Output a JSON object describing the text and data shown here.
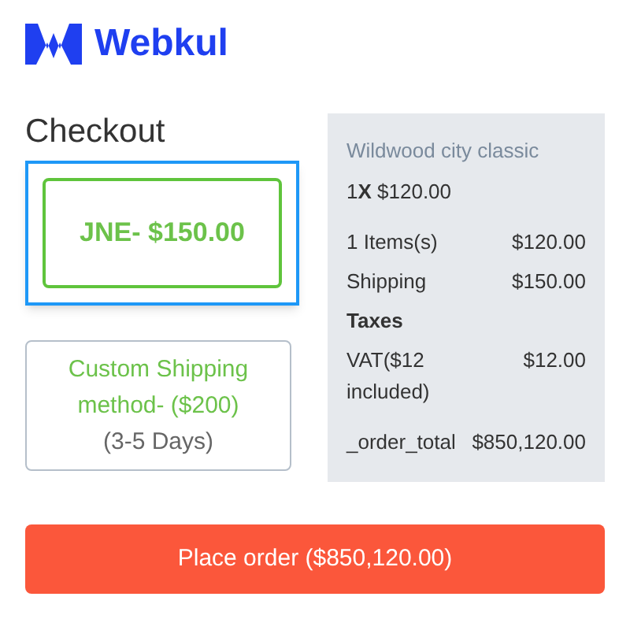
{
  "logo": {
    "text": "Webkul"
  },
  "title": "Checkout",
  "shipping_options": [
    {
      "label": "JNE- $150.00",
      "selected": true
    },
    {
      "label": "Custom Shipping method- ($200)",
      "detail": "(3-5 Days)",
      "selected": false
    }
  ],
  "summary": {
    "product": "Wildwood city classic",
    "quantity_price": "1**X** $120.00",
    "rows": [
      {
        "kind": "line",
        "label": "1 Items(s)",
        "value": "$120.00"
      },
      {
        "kind": "line",
        "label": "Shipping",
        "value": "$150.00"
      },
      {
        "kind": "heading",
        "label": "Taxes"
      },
      {
        "kind": "line",
        "label": "VAT($12 included)",
        "value": "$12.00"
      },
      {
        "kind": "total",
        "label": "_order_total",
        "value": "$850,120.00"
      }
    ]
  },
  "place_order_button": "Place order ($850,120.00)"
}
